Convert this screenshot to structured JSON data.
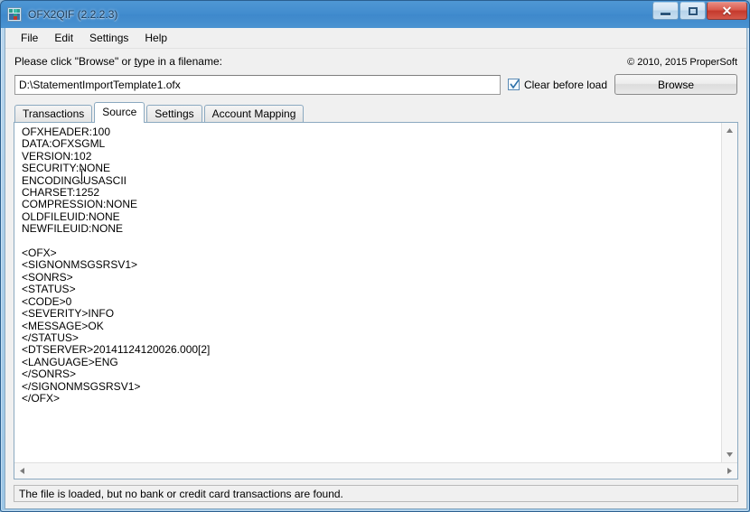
{
  "window": {
    "title": "OFX2QIF (2.2.2.3)",
    "app_icon": "app-icon",
    "controls": {
      "minimize": "minimize-button",
      "maximize": "maximize-button",
      "close": "✕"
    }
  },
  "menubar": {
    "items": [
      {
        "label": "File"
      },
      {
        "label": "Edit"
      },
      {
        "label": "Settings"
      },
      {
        "label": "Help"
      }
    ]
  },
  "toolbar": {
    "hint_prefix": "Please click \"Browse\" or ",
    "hint_accel": "t",
    "hint_suffix": "ype in a filename:",
    "copyright": "© 2010, 2015 ProperSoft",
    "file_path": "D:\\StatementImportTemplate1.ofx",
    "file_path_placeholder": "",
    "clear_before_load_label": "Clear before load",
    "clear_before_load_checked": true,
    "browse_label": "Browse"
  },
  "tabs": [
    {
      "label": "Transactions",
      "active": false
    },
    {
      "label": "Source",
      "active": true
    },
    {
      "label": "Settings",
      "active": false
    },
    {
      "label": "Account Mapping",
      "active": false
    }
  ],
  "source": {
    "content": "OFXHEADER:100\nDATA:OFXSGML\nVERSION:102\nSECURITY:NONE\nENCODING:USASCII\nCHARSET:1252\nCOMPRESSION:NONE\nOLDFILEUID:NONE\nNEWFILEUID:NONE\n\n<OFX>\n<SIGNONMSGSRSV1>\n<SONRS>\n<STATUS>\n<CODE>0\n<SEVERITY>INFO\n<MESSAGE>OK\n</STATUS>\n<DTSERVER>20141124120026.000[2]\n<LANGUAGE>ENG\n</SONRS>\n</SIGNONMSGSRSV1>\n</OFX>"
  },
  "statusbar": {
    "message": "The file is loaded, but no bank or credit card transactions are found."
  },
  "colors": {
    "titlebar": "#4a93d1",
    "close_button": "#c4392c",
    "client_background": "#f0f0f0",
    "text_background": "#ffffff",
    "border": "#8ba9c0"
  }
}
